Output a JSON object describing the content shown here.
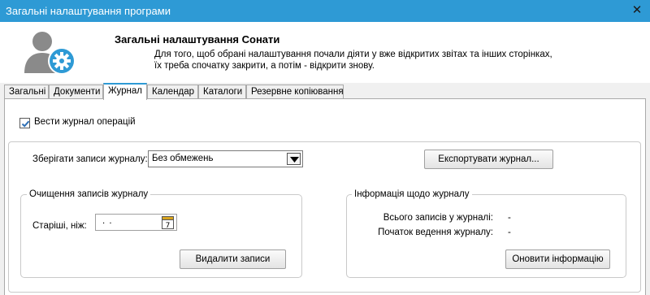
{
  "window": {
    "title": "Загальні налаштування програми",
    "close_glyph": "✕"
  },
  "header": {
    "title": "Загальні налаштування Сонати",
    "description": "Для того, щоб обрані налаштування почали діяти у вже відкритих звітах та інших сторінках, їх треба спочатку закрити, а потім - відкрити знову.",
    "icon": "user-settings-icon",
    "accent_color": "#2e9ad5"
  },
  "tabs": [
    {
      "label": "Загальні",
      "active": false
    },
    {
      "label": "Документи",
      "active": false
    },
    {
      "label": "Журнал",
      "active": true
    },
    {
      "label": "Календар",
      "active": false
    },
    {
      "label": "Каталоги",
      "active": false
    },
    {
      "label": "Резервне копіювання",
      "active": false
    }
  ],
  "journal": {
    "keep_log_label": "Вести журнал операцій",
    "keep_log_checked": true,
    "store_records_label": "Зберігати записи журналу:",
    "store_records_value": "Без обмежень",
    "export_button": "Експортувати журнал...",
    "cleanup": {
      "legend": "Очищення записів журналу",
      "older_than_label": "Старіші, ніж:",
      "date_value": ". .",
      "calendar_day": "7",
      "delete_button": "Видалити записи"
    },
    "info": {
      "legend": "Інформація щодо журналу",
      "total_label": "Всього записів у журналі:",
      "total_value": "-",
      "start_label": "Початок ведення журналу:",
      "start_value": "-",
      "refresh_button": "Оновити інформацію"
    }
  }
}
